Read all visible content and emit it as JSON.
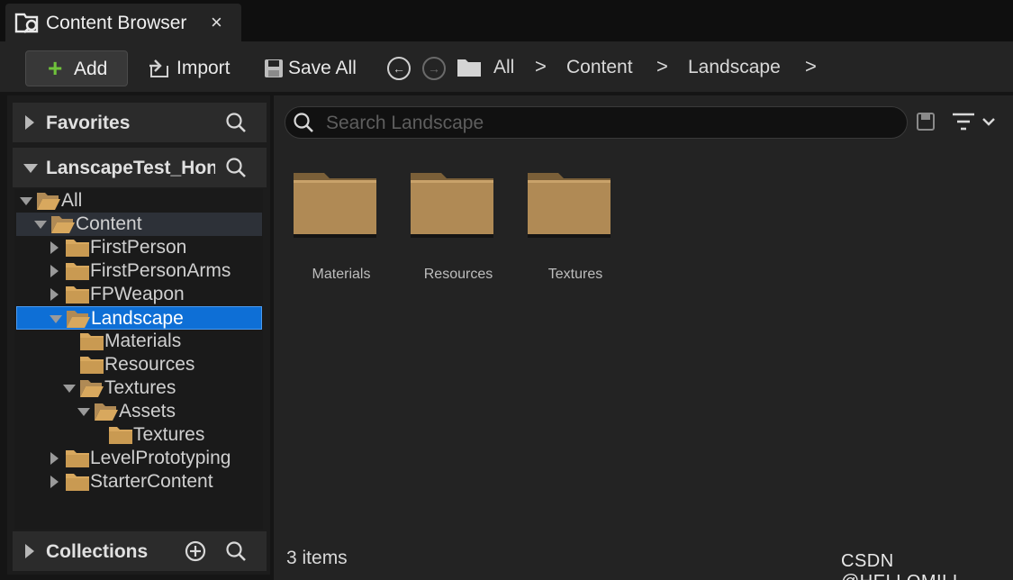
{
  "tab": {
    "title": "Content Browser",
    "close": "×"
  },
  "toolbar": {
    "add_label": "Add",
    "import_label": "Import",
    "save_all_label": "Save All",
    "breadcrumb": [
      "All",
      "Content",
      "Landscape"
    ],
    "separator": ">"
  },
  "sidebar": {
    "favorites_title": "Favorites",
    "project_title": "LanscapeTest_Hon",
    "collections_title": "Collections",
    "tree": [
      {
        "label": "All",
        "expanded": true,
        "state": "normal"
      },
      {
        "label": "Content",
        "expanded": true,
        "state": "highlight"
      },
      {
        "label": "FirstPerson",
        "expanded": false,
        "state": "normal"
      },
      {
        "label": "FirstPersonArms",
        "expanded": false,
        "state": "normal"
      },
      {
        "label": "FPWeapon",
        "expanded": false,
        "state": "normal"
      },
      {
        "label": "Landscape",
        "expanded": true,
        "state": "selected"
      },
      {
        "label": "Materials",
        "expanded": null,
        "state": "normal"
      },
      {
        "label": "Resources",
        "expanded": null,
        "state": "normal"
      },
      {
        "label": "Textures",
        "expanded": true,
        "state": "normal"
      },
      {
        "label": "Assets",
        "expanded": true,
        "state": "normal"
      },
      {
        "label": "Textures",
        "expanded": null,
        "state": "normal"
      },
      {
        "label": "LevelPrototyping",
        "expanded": false,
        "state": "normal"
      },
      {
        "label": "StarterContent",
        "expanded": false,
        "state": "normal"
      }
    ]
  },
  "main": {
    "search_placeholder": "Search Landscape",
    "items": [
      {
        "name": "Materials",
        "icon": "folder-icon"
      },
      {
        "name": "Resources",
        "icon": "folder-icon"
      },
      {
        "name": "Textures",
        "icon": "folder-icon"
      }
    ],
    "status": "3 items"
  },
  "watermark": "CSDN @HELLOMILI",
  "colors": {
    "accent_add": "#6fc23b",
    "selection": "#0e6fd6",
    "folder": "#b08a55"
  }
}
